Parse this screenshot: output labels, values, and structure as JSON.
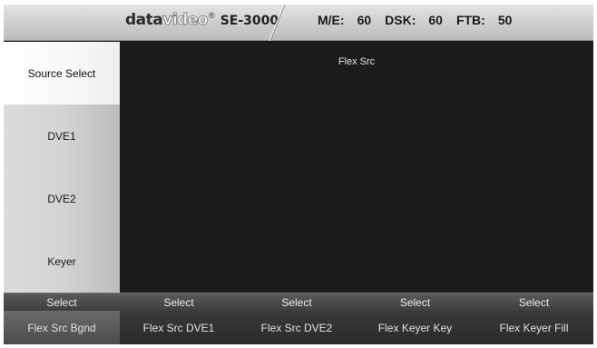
{
  "header": {
    "logo_data": "data",
    "logo_video": "video",
    "logo_mark": "®",
    "model": "SE-3000",
    "status": [
      {
        "label": "M/E:",
        "value": "60"
      },
      {
        "label": "DSK:",
        "value": "60"
      },
      {
        "label": "FTB:",
        "value": "50"
      }
    ]
  },
  "sidebar": {
    "items": [
      {
        "label": "Source Select",
        "active": true
      },
      {
        "label": "DVE1",
        "active": false
      },
      {
        "label": "DVE2",
        "active": false
      },
      {
        "label": "Keyer",
        "active": false
      }
    ]
  },
  "preview": {
    "label": "Flex Src"
  },
  "select_bar": {
    "buttons": [
      "Select",
      "Select",
      "Select",
      "Select",
      "Select"
    ]
  },
  "source_bar": {
    "items": [
      "Flex Src Bgnd",
      "Flex Src DVE1",
      "Flex Src DVE2",
      "Flex Keyer Key",
      "Flex Keyer Fill"
    ]
  },
  "colors": {
    "background": "#1b1b1b",
    "header": "#cdcdcd",
    "sidebar_active": "#ffffff",
    "sidebar_normal": "#d4d4d4"
  }
}
